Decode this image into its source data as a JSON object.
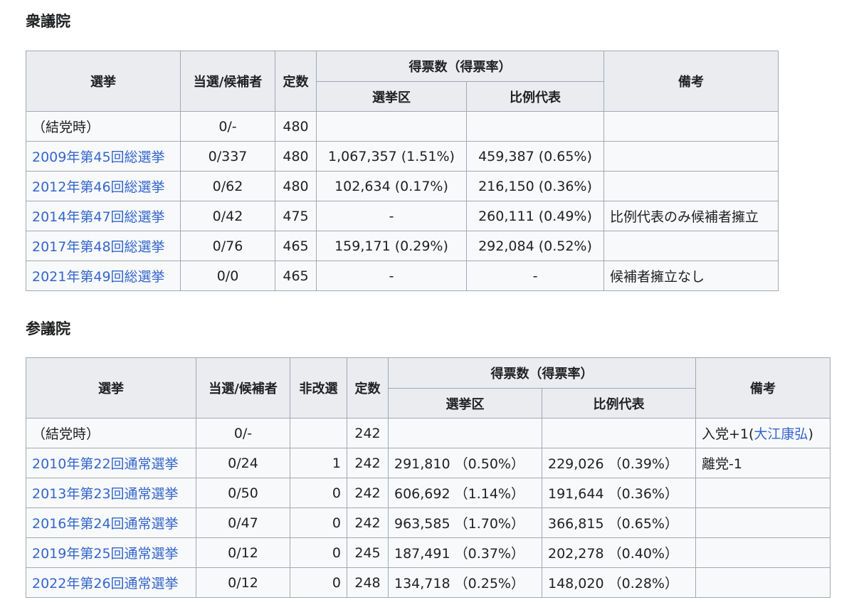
{
  "shugiin": {
    "title": "衆議院",
    "headers": {
      "election": "選挙",
      "elected_candidates": "当選/候補者",
      "seats": "定数",
      "votes": "得票数（得票率）",
      "district": "選挙区",
      "pr": "比例代表",
      "notes": "備考"
    },
    "rows": [
      {
        "election": "（結党時）",
        "link": false,
        "elected": "0/-",
        "seats": "480",
        "district": "",
        "pr": "",
        "notes": ""
      },
      {
        "election": "2009年第45回総選挙",
        "link": true,
        "elected": "0/337",
        "seats": "480",
        "district": "1,067,357 (1.51%)",
        "pr": "459,387 (0.65%)",
        "notes": ""
      },
      {
        "election": "2012年第46回総選挙",
        "link": true,
        "elected": "0/62",
        "seats": "480",
        "district": "102,634 (0.17%)",
        "pr": "216,150 (0.36%)",
        "notes": ""
      },
      {
        "election": "2014年第47回総選挙",
        "link": true,
        "elected": "0/42",
        "seats": "475",
        "district": "-",
        "pr": "260,111 (0.49%)",
        "notes": "比例代表のみ候補者擁立"
      },
      {
        "election": "2017年第48回総選挙",
        "link": true,
        "elected": "0/76",
        "seats": "465",
        "district": "159,171 (0.29%)",
        "pr": "292,084 (0.52%)",
        "notes": ""
      },
      {
        "election": "2021年第49回総選挙",
        "link": true,
        "elected": "0/0",
        "seats": "465",
        "district": "-",
        "pr": "-",
        "notes": "候補者擁立なし"
      }
    ]
  },
  "sangiin": {
    "title": "参議院",
    "headers": {
      "election": "選挙",
      "elected_candidates": "当選/候補者",
      "non_up": "非改選",
      "seats": "定数",
      "votes": "得票数（得票率）",
      "district": "選挙区",
      "pr": "比例代表",
      "notes": "備考"
    },
    "rows": [
      {
        "election": "（結党時）",
        "link": false,
        "elected": "0/-",
        "non_up": "",
        "seats": "242",
        "district": "",
        "pr": "",
        "notes_prefix": "入党+1(",
        "notes_link": "大江康弘",
        "notes_suffix": ")"
      },
      {
        "election": "2010年第22回通常選挙",
        "link": true,
        "elected": "0/24",
        "non_up": "1",
        "seats": "242",
        "district": "291,810 （0.50%）",
        "pr": "229,026 （0.39%）",
        "notes_prefix": "離党-1",
        "notes_link": "",
        "notes_suffix": ""
      },
      {
        "election": "2013年第23回通常選挙",
        "link": true,
        "elected": "0/50",
        "non_up": "0",
        "seats": "242",
        "district": "606,692 （1.14%）",
        "pr": "191,644 （0.36%）",
        "notes_prefix": "",
        "notes_link": "",
        "notes_suffix": ""
      },
      {
        "election": "2016年第24回通常選挙",
        "link": true,
        "elected": "0/47",
        "non_up": "0",
        "seats": "242",
        "district": "963,585 （1.70%）",
        "pr": "366,815 （0.65%）",
        "notes_prefix": "",
        "notes_link": "",
        "notes_suffix": ""
      },
      {
        "election": "2019年第25回通常選挙",
        "link": true,
        "elected": "0/12",
        "non_up": "0",
        "seats": "245",
        "district": "187,491 （0.37%）",
        "pr": "202,278 （0.40%）",
        "notes_prefix": "",
        "notes_link": "",
        "notes_suffix": ""
      },
      {
        "election": "2022年第26回通常選挙",
        "link": true,
        "elected": "0/12",
        "non_up": "0",
        "seats": "248",
        "district": "134,718 （0.25%）",
        "pr": "148,020 （0.28%）",
        "notes_prefix": "",
        "notes_link": "",
        "notes_suffix": ""
      }
    ]
  },
  "colors": {
    "link": "#3366cc",
    "header_bg": "#eaecf0",
    "cell_bg": "#f8f9fa",
    "border": "#a2a9b1"
  }
}
